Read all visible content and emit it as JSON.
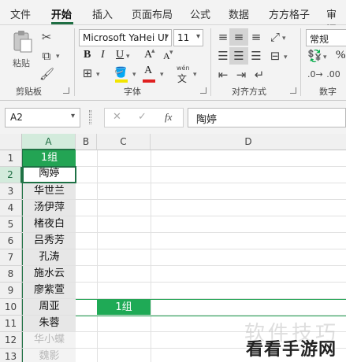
{
  "tabs": [
    "文件",
    "开始",
    "插入",
    "页面布局",
    "公式",
    "数据",
    "方方格子",
    "审阅"
  ],
  "ribbon": {
    "paste_label": "粘贴",
    "clipboard_label": "剪贴板",
    "font_name": "Microsoft YaHei UI",
    "font_size": "11",
    "font_group_label": "字体",
    "align_group_label": "对齐方式",
    "number_format": "常规",
    "number_group_label": "数字",
    "bold": "B",
    "italic": "I",
    "underline": "U",
    "grow_font": "A",
    "shrink_font": "A",
    "wen": "wén",
    "wen_char": "文",
    "font_color_letter": "A",
    "percent": "%",
    "accent_color": "#1f6e43",
    "font_color": "#e02020",
    "fill_color": "#f2e500"
  },
  "formula_bar": {
    "name_box": "A2",
    "cancel": "✕",
    "enter": "✓",
    "fx": "fx",
    "content": "陶婷"
  },
  "grid": {
    "columns": [
      "A",
      "B",
      "C",
      "D"
    ],
    "rows": [
      "1",
      "2",
      "3",
      "4",
      "5",
      "6",
      "7",
      "8",
      "9",
      "10",
      "11",
      "12",
      "13"
    ],
    "column_a": [
      "1组",
      "陶婷",
      "华世兰",
      "汤伊萍",
      "楮夜白",
      "吕秀芳",
      "孔涛",
      "施水云",
      "廖紫萱",
      "周亚",
      "朱蓉",
      "华小蝶",
      "魏影"
    ],
    "c2": "1组",
    "header_color": "#23a454"
  },
  "watermark": {
    "faded": "软件技巧",
    "site": "看看手游网"
  }
}
